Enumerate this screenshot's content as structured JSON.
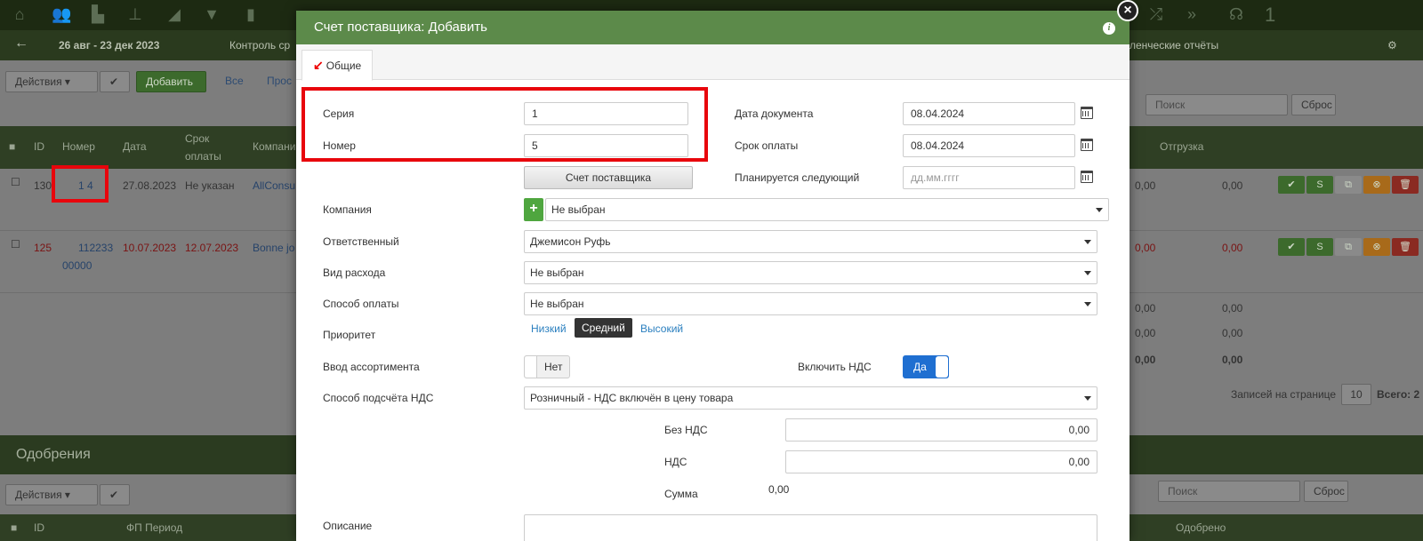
{
  "background": {
    "date_range": "26 авг - 23 дек 2023",
    "nav_control": "Контроль ср",
    "nav_reports": "ленческие отчёты",
    "notif_badge": "1",
    "toolbar": {
      "actions_label": "Действия",
      "add_label": "Добавить",
      "all_label": "Все",
      "overdue_label": "Прос",
      "search_placeholder": "Поиск",
      "reset_label": "Сброс"
    },
    "table": {
      "headers": [
        "ID",
        "Номер",
        "Дата",
        "Срок оплаты",
        "Компани",
        "Отгрузка"
      ],
      "rows": [
        {
          "id": "130",
          "number": "1 4",
          "date": "27.08.2023",
          "due": "Не указан",
          "company": "AllConsu",
          "amount": "0,00",
          "shipment": "0,00"
        },
        {
          "id": "125",
          "number": "112233",
          "number2": "00000",
          "date": "10.07.2023",
          "due": "12.07.2023",
          "company": "Bonne jo",
          "amount": "0,00",
          "shipment": "0,00"
        }
      ],
      "extra_values": [
        "0,00",
        "0,00",
        "0,00",
        "0,00",
        "0,00",
        "0,00"
      ],
      "records_per_page_label": "Записей на странице",
      "records_per_page": "10",
      "total_label": "Всего: 2"
    },
    "approvals": {
      "title": "Одобрения",
      "actions_label": "Действия",
      "search_placeholder": "Поиск",
      "reset_label": "Сброс",
      "headers": [
        "ID",
        "ФП Период",
        "Одобрено"
      ]
    }
  },
  "modal": {
    "title": "Счет поставщика: Добавить",
    "tab_general": "Общие",
    "fields": {
      "series_label": "Серия",
      "series_value": "1",
      "number_label": "Номер",
      "number_value": "5",
      "doc_type_button": "Счет поставщика",
      "doc_date_label": "Дата документа",
      "doc_date_value": "08.04.2024",
      "due_date_label": "Срок оплаты",
      "due_date_value": "08.04.2024",
      "next_planned_label": "Планируется следующий",
      "next_planned_placeholder": "дд.мм.гггг",
      "company_label": "Компания",
      "company_value": "Не выбран",
      "responsible_label": "Ответственный",
      "responsible_value": "Джемисон Руфь",
      "expense_type_label": "Вид расхода",
      "expense_type_value": "Не выбран",
      "payment_method_label": "Способ оплаты",
      "payment_method_value": "Не выбран",
      "priority_label": "Приоритет",
      "priority_low": "Низкий",
      "priority_mid": "Средний",
      "priority_high": "Высокий",
      "assortment_label": "Ввод ассортимента",
      "assortment_value": "Нет",
      "vat_include_label": "Включить НДС",
      "vat_include_value": "Да",
      "vat_calc_label": "Способ подсчёта НДС",
      "vat_calc_value": "Розничный - НДС включён в цену товара",
      "without_vat_label": "Без НДС",
      "without_vat_value": "0,00",
      "vat_label": "НДС",
      "vat_value": "0,00",
      "sum_label": "Сумма",
      "sum_value": "0,00",
      "description_label": "Описание"
    }
  }
}
